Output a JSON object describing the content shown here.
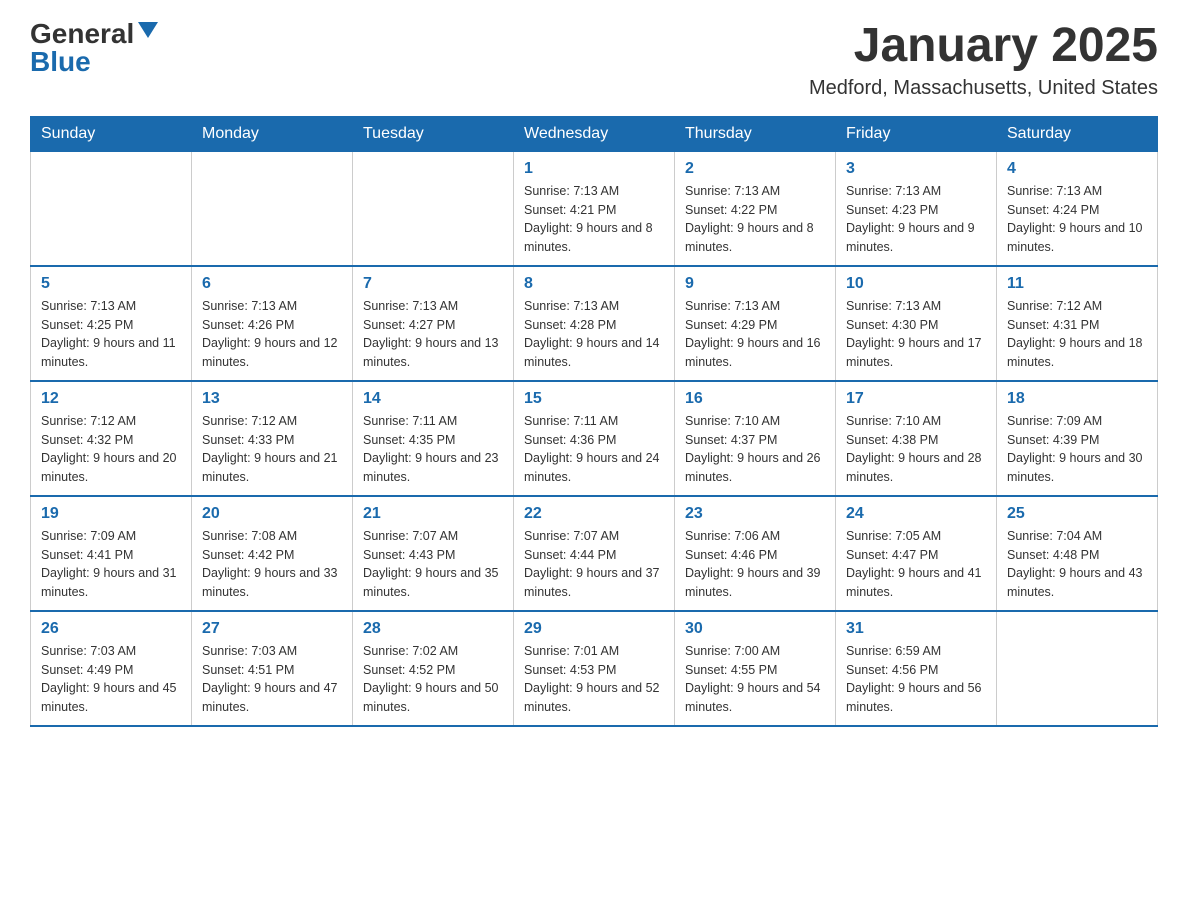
{
  "header": {
    "logo_general": "General",
    "logo_blue": "Blue",
    "month_title": "January 2025",
    "location": "Medford, Massachusetts, United States"
  },
  "days_of_week": [
    "Sunday",
    "Monday",
    "Tuesday",
    "Wednesday",
    "Thursday",
    "Friday",
    "Saturday"
  ],
  "weeks": [
    [
      {
        "day": "",
        "info": ""
      },
      {
        "day": "",
        "info": ""
      },
      {
        "day": "",
        "info": ""
      },
      {
        "day": "1",
        "info": "Sunrise: 7:13 AM\nSunset: 4:21 PM\nDaylight: 9 hours and 8 minutes."
      },
      {
        "day": "2",
        "info": "Sunrise: 7:13 AM\nSunset: 4:22 PM\nDaylight: 9 hours and 8 minutes."
      },
      {
        "day": "3",
        "info": "Sunrise: 7:13 AM\nSunset: 4:23 PM\nDaylight: 9 hours and 9 minutes."
      },
      {
        "day": "4",
        "info": "Sunrise: 7:13 AM\nSunset: 4:24 PM\nDaylight: 9 hours and 10 minutes."
      }
    ],
    [
      {
        "day": "5",
        "info": "Sunrise: 7:13 AM\nSunset: 4:25 PM\nDaylight: 9 hours and 11 minutes."
      },
      {
        "day": "6",
        "info": "Sunrise: 7:13 AM\nSunset: 4:26 PM\nDaylight: 9 hours and 12 minutes."
      },
      {
        "day": "7",
        "info": "Sunrise: 7:13 AM\nSunset: 4:27 PM\nDaylight: 9 hours and 13 minutes."
      },
      {
        "day": "8",
        "info": "Sunrise: 7:13 AM\nSunset: 4:28 PM\nDaylight: 9 hours and 14 minutes."
      },
      {
        "day": "9",
        "info": "Sunrise: 7:13 AM\nSunset: 4:29 PM\nDaylight: 9 hours and 16 minutes."
      },
      {
        "day": "10",
        "info": "Sunrise: 7:13 AM\nSunset: 4:30 PM\nDaylight: 9 hours and 17 minutes."
      },
      {
        "day": "11",
        "info": "Sunrise: 7:12 AM\nSunset: 4:31 PM\nDaylight: 9 hours and 18 minutes."
      }
    ],
    [
      {
        "day": "12",
        "info": "Sunrise: 7:12 AM\nSunset: 4:32 PM\nDaylight: 9 hours and 20 minutes."
      },
      {
        "day": "13",
        "info": "Sunrise: 7:12 AM\nSunset: 4:33 PM\nDaylight: 9 hours and 21 minutes."
      },
      {
        "day": "14",
        "info": "Sunrise: 7:11 AM\nSunset: 4:35 PM\nDaylight: 9 hours and 23 minutes."
      },
      {
        "day": "15",
        "info": "Sunrise: 7:11 AM\nSunset: 4:36 PM\nDaylight: 9 hours and 24 minutes."
      },
      {
        "day": "16",
        "info": "Sunrise: 7:10 AM\nSunset: 4:37 PM\nDaylight: 9 hours and 26 minutes."
      },
      {
        "day": "17",
        "info": "Sunrise: 7:10 AM\nSunset: 4:38 PM\nDaylight: 9 hours and 28 minutes."
      },
      {
        "day": "18",
        "info": "Sunrise: 7:09 AM\nSunset: 4:39 PM\nDaylight: 9 hours and 30 minutes."
      }
    ],
    [
      {
        "day": "19",
        "info": "Sunrise: 7:09 AM\nSunset: 4:41 PM\nDaylight: 9 hours and 31 minutes."
      },
      {
        "day": "20",
        "info": "Sunrise: 7:08 AM\nSunset: 4:42 PM\nDaylight: 9 hours and 33 minutes."
      },
      {
        "day": "21",
        "info": "Sunrise: 7:07 AM\nSunset: 4:43 PM\nDaylight: 9 hours and 35 minutes."
      },
      {
        "day": "22",
        "info": "Sunrise: 7:07 AM\nSunset: 4:44 PM\nDaylight: 9 hours and 37 minutes."
      },
      {
        "day": "23",
        "info": "Sunrise: 7:06 AM\nSunset: 4:46 PM\nDaylight: 9 hours and 39 minutes."
      },
      {
        "day": "24",
        "info": "Sunrise: 7:05 AM\nSunset: 4:47 PM\nDaylight: 9 hours and 41 minutes."
      },
      {
        "day": "25",
        "info": "Sunrise: 7:04 AM\nSunset: 4:48 PM\nDaylight: 9 hours and 43 minutes."
      }
    ],
    [
      {
        "day": "26",
        "info": "Sunrise: 7:03 AM\nSunset: 4:49 PM\nDaylight: 9 hours and 45 minutes."
      },
      {
        "day": "27",
        "info": "Sunrise: 7:03 AM\nSunset: 4:51 PM\nDaylight: 9 hours and 47 minutes."
      },
      {
        "day": "28",
        "info": "Sunrise: 7:02 AM\nSunset: 4:52 PM\nDaylight: 9 hours and 50 minutes."
      },
      {
        "day": "29",
        "info": "Sunrise: 7:01 AM\nSunset: 4:53 PM\nDaylight: 9 hours and 52 minutes."
      },
      {
        "day": "30",
        "info": "Sunrise: 7:00 AM\nSunset: 4:55 PM\nDaylight: 9 hours and 54 minutes."
      },
      {
        "day": "31",
        "info": "Sunrise: 6:59 AM\nSunset: 4:56 PM\nDaylight: 9 hours and 56 minutes."
      },
      {
        "day": "",
        "info": ""
      }
    ]
  ]
}
